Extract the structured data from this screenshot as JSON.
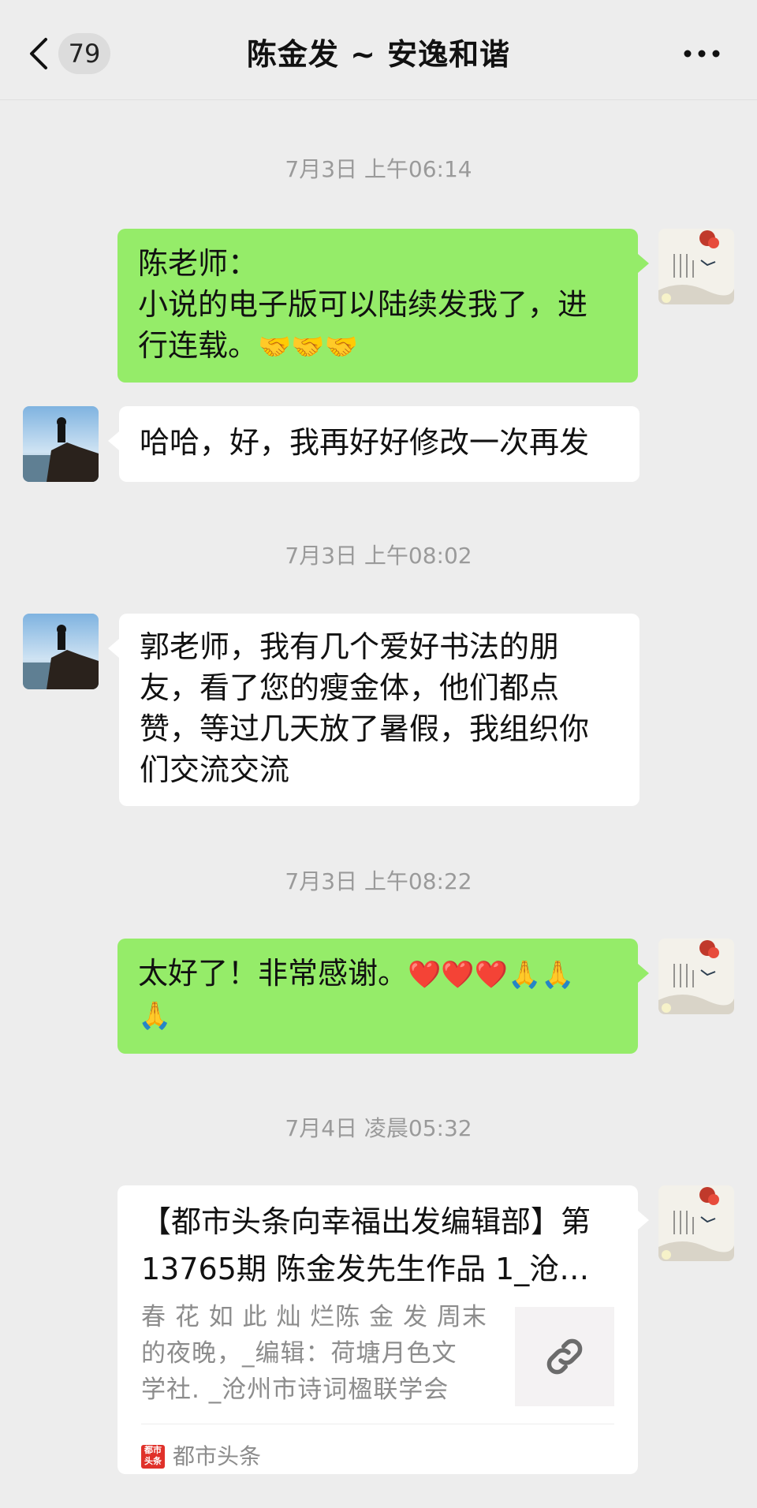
{
  "header": {
    "back_label": "返回",
    "unread_count": "79",
    "title": "陈金发 ~ 安逸和谐",
    "more_label": "更多"
  },
  "colors": {
    "background": "#ededed",
    "my_bubble": "#95ec69",
    "other_bubble": "#ffffff",
    "timestamp_text": "#9a9a9a"
  },
  "messages": [
    {
      "type": "timestamp",
      "text": "7月3日 上午06:14"
    },
    {
      "type": "text",
      "sender": "me",
      "line1": "陈老师：",
      "line2": "小说的电子版可以陆续发我了，进",
      "line3": "行连载。",
      "emoji": "🤝🤝🤝"
    },
    {
      "type": "text",
      "sender": "other",
      "text": "哈哈，好，我再好好修改一次再发"
    },
    {
      "type": "timestamp",
      "text": "7月3日 上午08:02"
    },
    {
      "type": "text",
      "sender": "other",
      "line1": "郭老师，我有几个爱好书法的朋",
      "line2": "友，看了您的瘦金体，他们都点",
      "line3": "赞，等过几天放了暑假，我组织你",
      "line4": "们交流交流"
    },
    {
      "type": "timestamp",
      "text": "7月3日 上午08:22"
    },
    {
      "type": "text",
      "sender": "me",
      "text": "太好了！非常感谢。",
      "emoji": "❤️❤️❤️🙏🙏",
      "emoji2": "🙏"
    },
    {
      "type": "timestamp",
      "text": "7月4日 凌晨05:32"
    },
    {
      "type": "link",
      "sender": "me",
      "title_line1": "【都市头条向幸福出发编辑部】第",
      "title_line2": "13765期 陈金发先生作品 1_沧…",
      "desc_line1": "春 花 如 此 灿 烂陈 金 发 周末",
      "desc_line2": "的夜晚，_编辑：荷塘月色文",
      "desc_line3": "学社. _沧州市诗词楹联学会",
      "source_logo": "都市头条",
      "source": "都市头条",
      "thumb_icon": "link-icon"
    }
  ]
}
